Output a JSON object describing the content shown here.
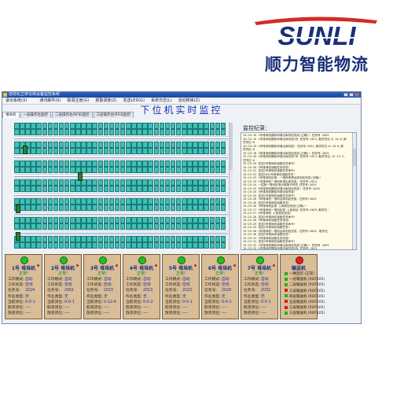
{
  "brand": {
    "latin": "SUNLI",
    "chinese": "顺力智能物流",
    "color_red": "#d42b25",
    "color_blue": "#1a2f78"
  },
  "window": {
    "title": "自动化立体仓库设备监控系统"
  },
  "menu": [
    "退出系统(X)",
    "",
    "通讯邮件(S)",
    "联调注册(G)",
    "报警调度(Z)",
    "发送LED(G)",
    "系统日志(L)",
    "自动移库(Z)"
  ],
  "page_title": "下位机实时监控",
  "tabs": [
    "堆垛机",
    "一层操作台监控",
    "二层操作台/RFID监控",
    "三层操作台/RFID监控"
  ],
  "log": {
    "label": "监控纪录：",
    "lines": [
      "15:23:15 1号堆垛机删除申请出库到站完成(正确)! 任务号 2025",
      "15:23:15 1号堆垛机删除申请出库完成2号 任务号:2011,取货货位:6-10-6,卸",
      "货货位:0",
      "15:23:15 2号堆垛机删除申请出库完成! 任务号:2011,取货货位:6-10-6,卸",
      "货货位:0",
      "15:23:18 2号堆垛机删除申请出库到站完成(正确)! 任务号:2025",
      "15:23:20 2号堆垛机删除申请出库完成7号 任务号:2011,取货货位:12-23-5,",
      "货货位:0",
      "15:23:20 发送2号堆垛机读取任务命令!",
      "15:23:20 2号堆垛机读取任务完成!",
      "15:23:22 发送2号堆垛机读取任务命令!",
      "15:23:22 发送2054号堆垛机读取任务!",
      "15:23:23 1号堆垛机反馈：一堆码申请出库到站完成(正确)!",
      "15:23:23 1号堆垛机一堆码申请出库完成: 任务号:2011",
      "15:23:24 一层库一堆码反馈出库指令完成 任务号:2025",
      "15:23:25 3号堆垛机删除申请出库到站完成! 任务号:2025",
      "15:23:25 3号堆垛机删除申请出库完成!",
      "15:23:25 发送2号堆垛机读取任务命令!",
      "15:23:26 3号堆垛机一堆码出库到站完成，任务号:2025",
      "15:23:26 发送3号堆垛机读取任务!",
      "15:23:26 3号堆垛机反馈 入库到站完成(正确)!",
      "15:23:27 3号堆垛机一堆码反馈 入库到站 任务号:2025,取货位:",
      "15:23:27 4号堆垛机 入库到站完成!",
      "15:23:28 发送3号堆垛机读取任务命令!",
      "15:23:28 3号堆垛机读取任务完成!",
      "15:23:29 发送3号堆垛机读取任务命令!",
      "15:23:29 发送2号堆垛机读取任务!",
      "15:23:30 3号堆垛机一堆码出库到站完成，任务号:2025，取货位",
      "15:23:30 发送3号堆垛机读取任务!",
      "15:23:31 3号堆垛机读取任务完成!",
      "15:23:31 发送3号堆垛机读取任务命令!",
      "15:23:32 1号堆垛机删除申请出库到站完成(正确)! 任务号 2025",
      "15:23:32 1号堆垛机删除申请出库完成2号 任务号 2011",
      "15:23:33 2011 2025 删除任务完成!",
      "15:23:34 3号堆垛机 入库到站完成!",
      "15:23:34 2025 2011 出库完成!"
    ]
  },
  "card_labels": {
    "mode": "工作模式:",
    "status": "工作状态:",
    "task": "任务号:",
    "work": "作业类型:",
    "cur": "当前货位:",
    "load": "取货货位:",
    "unload": "放货货位:"
  },
  "stackers": [
    {
      "title": "1号 堆垛机",
      "state": "正常!",
      "mode": "自动",
      "status": "空闲",
      "task": "2024",
      "work": "无",
      "cur": "0-0-1",
      "load": "----",
      "unload": "----"
    },
    {
      "title": "2号 堆垛机",
      "state": "正常!",
      "mode": "自动",
      "status": "空闲",
      "task": "2001",
      "work": "无",
      "cur": "0-0-1",
      "load": "----",
      "unload": "----"
    },
    {
      "title": "3号 堆垛机",
      "state": "正常!",
      "mode": "自动",
      "status": "空闲",
      "task": "2015",
      "work": "无",
      "cur": "0-12-4",
      "load": "----",
      "unload": "----"
    },
    {
      "title": "4号 堆垛机",
      "state": "正常!",
      "mode": "自动",
      "status": "空闲",
      "task": "2013",
      "work": "无",
      "cur": "0-0-2",
      "load": "----",
      "unload": "----"
    },
    {
      "title": "5号 堆垛机",
      "state": "正常!",
      "mode": "自动",
      "status": "空闲",
      "task": "2023",
      "work": "无",
      "cur": "0-0-1",
      "load": "----",
      "unload": "----"
    },
    {
      "title": "6号 堆垛机",
      "state": "正常!",
      "mode": "自动",
      "status": "空闲",
      "task": "2029",
      "work": "无",
      "cur": "0-0-1",
      "load": "----",
      "unload": "----"
    },
    {
      "title": "7号 堆垛机",
      "state": "正常!",
      "mode": "自动",
      "status": "空闲",
      "task": "2032",
      "work": "无",
      "cur": "0-0-1",
      "load": "----",
      "unload": "----"
    }
  ],
  "alarm": {
    "title": "输送机",
    "items": [
      {
        "label": "一楼监控 (正常)",
        "color": "#1ab51a"
      },
      {
        "label": "一层输送机 (ROF105)",
        "color": "#1ab51a"
      },
      {
        "label": "二层输送机 (ROF105)",
        "color": "#1ab51a"
      },
      {
        "label": "三层输送机 (ROF105)",
        "color": "#d02020"
      },
      {
        "label": "四层输送机 (ROF105)",
        "color": "#1ab51a"
      },
      {
        "label": "五层输送机 (ROF105)",
        "color": "#d02020"
      },
      {
        "label": "三层输送机 (ROF105)",
        "color": "#d02020"
      },
      {
        "label": "三层输送机 (ROF105)",
        "color": "#1ab51a"
      }
    ]
  },
  "grid_colors": {
    "slot": "#3ec0b8",
    "stacker": "#2d7d3a"
  }
}
